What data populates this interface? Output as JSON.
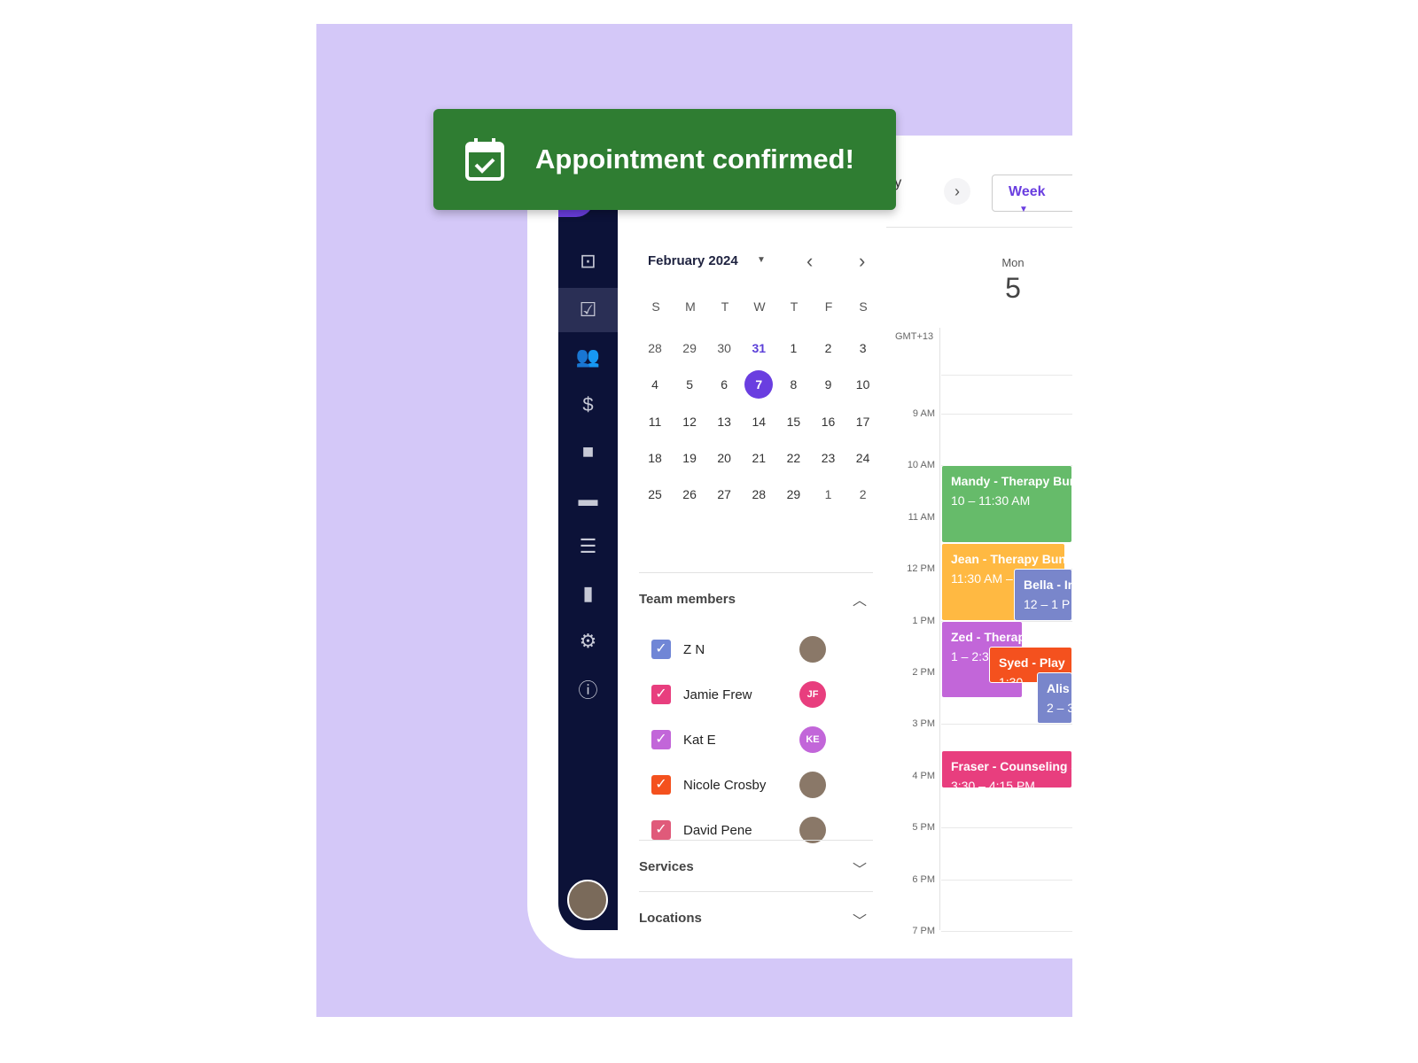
{
  "toast": {
    "message": "Appointment confirmed!",
    "icon": "calendar-check-icon",
    "color": "#2f7d32"
  },
  "header": {
    "month_partial": "ary",
    "view": "Week"
  },
  "sidebar": {
    "items": [
      "inbox-icon",
      "calendar-check-icon",
      "people-icon",
      "dollar-icon",
      "video-icon",
      "briefcase-icon",
      "list-icon",
      "document-icon",
      "gear-icon",
      "help-icon"
    ],
    "active": 1
  },
  "mini_calendar": {
    "title": "February 2024",
    "weekdays": [
      "S",
      "M",
      "T",
      "W",
      "T",
      "F",
      "S"
    ],
    "weeks": [
      [
        "28",
        "29",
        "30",
        "31",
        "1",
        "2",
        "3"
      ],
      [
        "4",
        "5",
        "6",
        "7",
        "8",
        "9",
        "10"
      ],
      [
        "11",
        "12",
        "13",
        "14",
        "15",
        "16",
        "17"
      ],
      [
        "18",
        "19",
        "20",
        "21",
        "22",
        "23",
        "24"
      ],
      [
        "25",
        "26",
        "27",
        "28",
        "29",
        "1",
        "2"
      ]
    ],
    "today": "31",
    "selected": "7"
  },
  "team": {
    "title": "Team members",
    "members": [
      {
        "name": "Z N",
        "color": "#7086d6",
        "initials": ""
      },
      {
        "name": "Jamie Frew",
        "color": "#e83e7e",
        "initials": "JF"
      },
      {
        "name": "Kat E",
        "color": "#c266d9",
        "initials": "KE"
      },
      {
        "name": "Nicole Crosby",
        "color": "#f4511e",
        "initials": ""
      },
      {
        "name": "David Pene",
        "color": "#e05a7a",
        "initials": ""
      }
    ]
  },
  "services": {
    "title": "Services"
  },
  "locations": {
    "title": "Locations"
  },
  "day_view": {
    "dow": "Mon",
    "date": "5",
    "timezone": "GMT+13",
    "hours": [
      "9 AM",
      "10 AM",
      "11 AM",
      "12 PM",
      "1 PM",
      "2 PM",
      "3 PM",
      "4 PM",
      "5 PM",
      "6 PM",
      "7 PM"
    ],
    "events": [
      {
        "title": "Mandy - Therapy Bun",
        "time": "10 – 11:30 AM",
        "color": "#66bb6a"
      },
      {
        "title": "Jean - Therapy Bun",
        "time": "11:30 AM –",
        "color": "#ffb942"
      },
      {
        "title": "Bella - In",
        "time": "12 – 1 P",
        "color": "#7986cb"
      },
      {
        "title": "Zed - Therap",
        "time": "1 – 2:3",
        "color": "#c266d9"
      },
      {
        "title": "Syed - Play",
        "time": "1:30 –",
        "color": "#f4511e"
      },
      {
        "title": "Alis",
        "time": "2 – 3",
        "color": "#7986cb"
      },
      {
        "title": "Fraser - Counseling S",
        "time": "3:30 – 4:15 PM",
        "color": "#e83e7e"
      }
    ]
  }
}
